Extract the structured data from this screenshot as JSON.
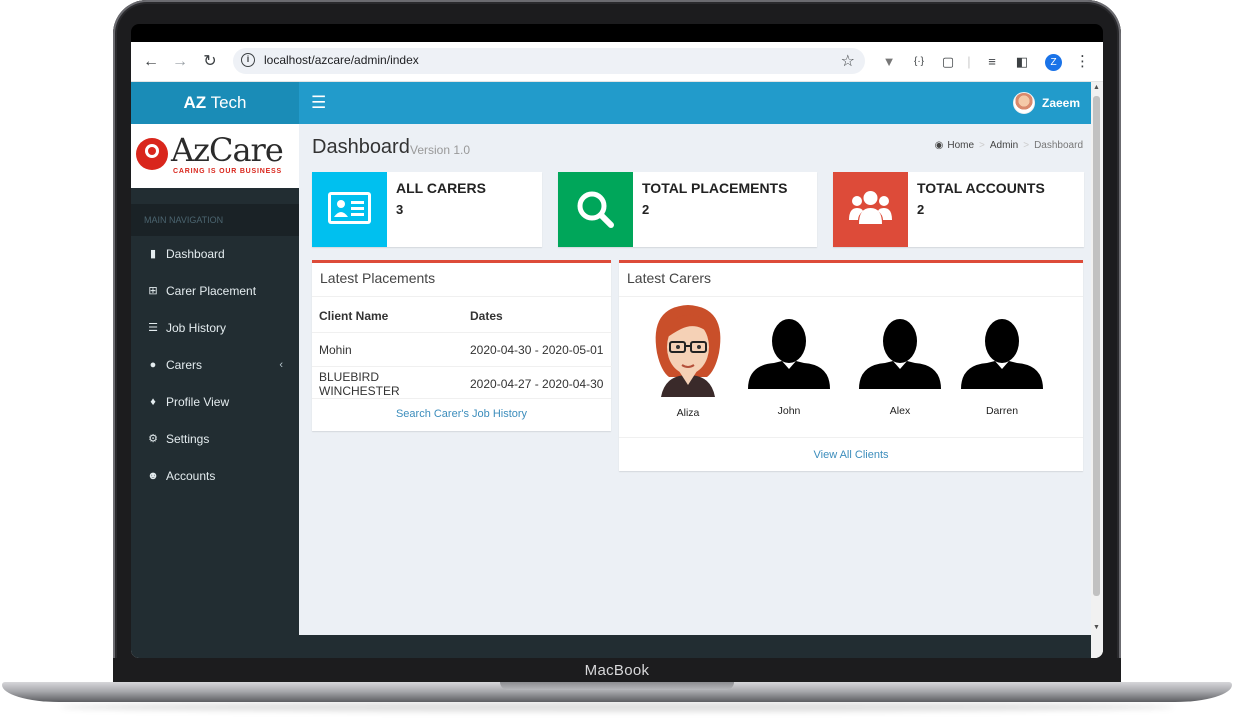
{
  "device": {
    "label": "MacBook"
  },
  "browser": {
    "back_icon": "arrow-left-icon",
    "forward_icon": "arrow-right-icon",
    "reload_icon": "reload-icon",
    "url": "localhost/azcare/admin/index",
    "profile_initial": "Z"
  },
  "header": {
    "brand_bold": "AZ",
    "brand_rest": " Tech",
    "user_name": "Zaeem",
    "colors": {
      "brand": "#1a8cb7",
      "topbar": "#229bcb"
    }
  },
  "logo": {
    "name": "AzCare",
    "tagline": "CARING IS OUR BUSINESS"
  },
  "sidebar": {
    "nav_header": "MAIN NAVIGATION",
    "items": [
      {
        "label": "Dashboard",
        "icon": "book-icon"
      },
      {
        "label": "Carer Placement",
        "icon": "plus-square-icon"
      },
      {
        "label": "Job History",
        "icon": "list-icon"
      },
      {
        "label": "Carers",
        "icon": "user-icon",
        "has_submenu": true
      },
      {
        "label": "Profile View",
        "icon": "user-secret-icon"
      },
      {
        "label": "Settings",
        "icon": "gear-icon"
      },
      {
        "label": "Accounts",
        "icon": "users-icon"
      }
    ]
  },
  "page": {
    "title": "Dashboard",
    "version": "Version 1.0",
    "breadcrumb": [
      "Home",
      "Admin",
      "Dashboard"
    ]
  },
  "stats": [
    {
      "label": "ALL CARERS",
      "value": "3",
      "color": "#00c0ef",
      "icon": "id-card-icon"
    },
    {
      "label": "TOTAL PLACEMENTS",
      "value": "2",
      "color": "#00a65a",
      "icon": "search-icon"
    },
    {
      "label": "TOTAL ACCOUNTS",
      "value": "2",
      "color": "#dd4b39",
      "icon": "users-icon"
    }
  ],
  "placements": {
    "title": "Latest Placements",
    "columns": [
      "Client Name",
      "Dates"
    ],
    "rows": [
      [
        "Mohin",
        "2020-04-30 - 2020-05-01"
      ],
      [
        "BLUEBIRD WINCHESTER",
        "2020-04-27 - 2020-04-30"
      ]
    ],
    "footer_link": "Search Carer's Job History"
  },
  "carers": {
    "title": "Latest Carers",
    "items": [
      {
        "name": "Aliza",
        "avatar": "female-cartoon-avatar"
      },
      {
        "name": "John",
        "avatar": "silhouette-avatar"
      },
      {
        "name": "Alex",
        "avatar": "silhouette-avatar"
      },
      {
        "name": "Darren",
        "avatar": "silhouette-avatar"
      }
    ],
    "footer_link": "View All Clients"
  }
}
